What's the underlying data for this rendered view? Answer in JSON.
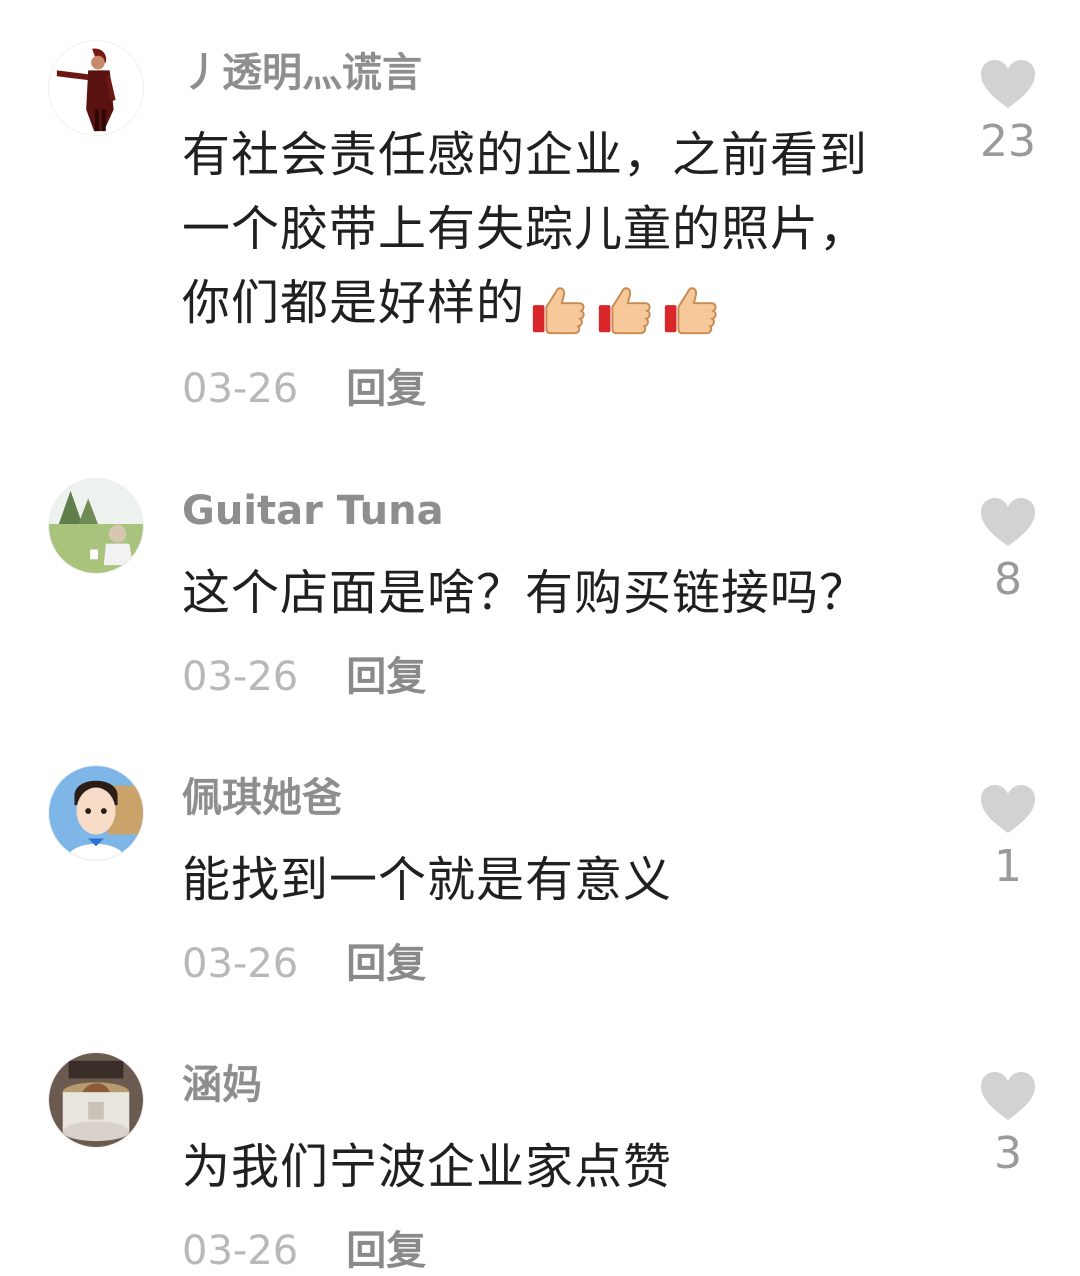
{
  "comments": [
    {
      "username": "丿透明灬谎言",
      "lines": [
        "有社会责任感的企业，之前看到",
        "一个胶带上有失踪儿童的照片，",
        "你们都是好样的"
      ],
      "emoji": [
        "thumbs-up-icon",
        "thumbs-up-icon",
        "thumbs-up-icon"
      ],
      "date": "03-26",
      "reply": "回复",
      "likes": "23"
    },
    {
      "username": "Guitar Tuna",
      "lines": [
        "这个店面是啥？有购买链接吗？"
      ],
      "date": "03-26",
      "reply": "回复",
      "likes": "8"
    },
    {
      "username": "佩琪她爸",
      "lines": [
        "能找到一个就是有意义"
      ],
      "date": "03-26",
      "reply": "回复",
      "likes": "1"
    },
    {
      "username": "涵妈",
      "lines": [
        "为我们宁波企业家点赞"
      ],
      "date": "03-26",
      "reply": "回复",
      "likes": "3"
    }
  ],
  "colors": {
    "username": "#8e8e8e",
    "text": "#202020",
    "date": "#b8b8b8",
    "reply": "#8a8a8a",
    "heart": "#d2d2d2"
  }
}
